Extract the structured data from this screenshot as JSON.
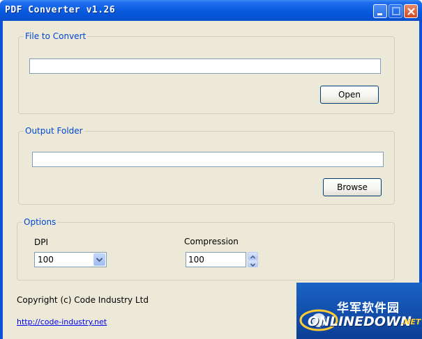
{
  "window": {
    "title": "PDF Converter v1.26"
  },
  "file_group": {
    "legend": "File to Convert",
    "input_value": "",
    "open_label": "Open"
  },
  "output_group": {
    "legend": "Output Folder",
    "input_value": "",
    "browse_label": "Browse"
  },
  "options_group": {
    "legend": "Options",
    "dpi_label": "DPI",
    "dpi_value": "100",
    "compression_label": "Compression",
    "compression_value": "100"
  },
  "footer": {
    "copyright": "Copyright (c) Code Industry Ltd",
    "link": "http://code-industry.net"
  },
  "watermark": {
    "chinese": "华军软件园",
    "brand": "ONLINEDOWN",
    "suffix": ".NET"
  },
  "colors": {
    "titlebar": "#0a5ce0",
    "client_bg": "#ece9d8",
    "legend_text": "#0046d5",
    "link": "#0000ee"
  }
}
